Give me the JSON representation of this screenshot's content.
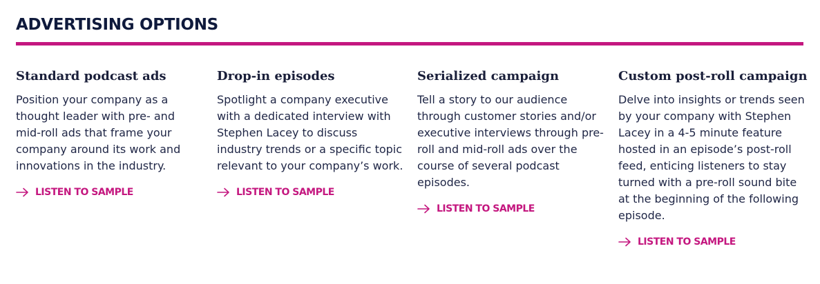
{
  "section": {
    "title": "ADVERTISING OPTIONS"
  },
  "colors": {
    "accent": "#c4177f",
    "heading": "#0f1a3c",
    "body_text": "#1e2545"
  },
  "options": [
    {
      "title": "Standard podcast ads",
      "body": "Position your company as a thought leader with pre- and mid-roll ads that frame your company around its work and innovations in the industry.",
      "cta": "LISTEN TO SAMPLE",
      "icon": "arrow-right-icon"
    },
    {
      "title": "Drop-in episodes",
      "body": "Spotlight a company executive with a dedicated interview with Stephen Lacey to discuss industry trends or a specific topic relevant to your company’s work.",
      "cta": "LISTEN TO SAMPLE",
      "icon": "arrow-right-icon"
    },
    {
      "title": "Serialized campaign",
      "body": "Tell a story to our audience through customer stories and/or executive interviews through pre-roll and mid-roll ads over the course of several podcast episodes.",
      "cta": "LISTEN TO SAMPLE",
      "icon": "arrow-right-icon"
    },
    {
      "title": "Custom post-roll campaign",
      "body": "Delve into insights or trends seen by your company with Stephen Lacey in a 4-5 minute feature hosted in an episode’s post-roll feed, enticing listeners to stay turned with a pre-roll sound bite at the beginning of the following episode.",
      "cta": "LISTEN TO SAMPLE",
      "icon": "arrow-right-icon"
    }
  ]
}
